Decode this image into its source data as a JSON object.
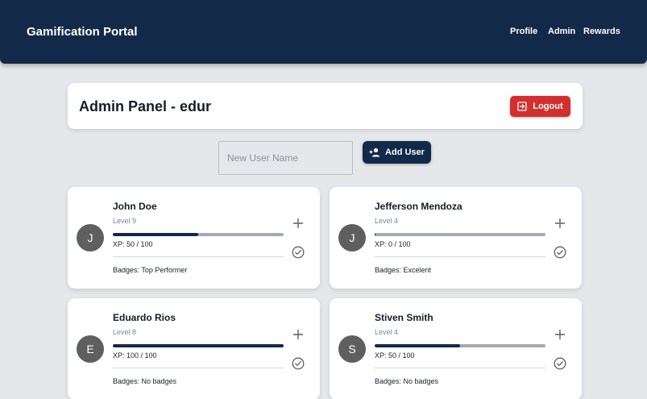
{
  "header": {
    "title": "Gamification Portal",
    "nav": [
      "Profile",
      "Admin",
      "Rewards"
    ]
  },
  "admin_panel": {
    "title": "Admin Panel - edur",
    "logout_label": "Logout",
    "logout_icon": "logout-icon",
    "logout_color": "#d32f2f"
  },
  "add_user": {
    "placeholder": "New User Name",
    "value": "",
    "button_label": "Add User",
    "button_icon": "person-add-icon"
  },
  "users": [
    {
      "initial": "J",
      "name": "John Doe",
      "level": "Level 9",
      "xp_text": "XP: 50 / 100",
      "xp_progress": 0.5,
      "badges": "Badges: Top Performer"
    },
    {
      "initial": "J",
      "name": "Jefferson Mendoza",
      "level": "Level 4",
      "xp_text": "XP: 0 / 100",
      "xp_progress": 0.0,
      "badges": "Badges: Excelent"
    },
    {
      "initial": "E",
      "name": "Eduardo Rios",
      "level": "Level 8",
      "xp_text": "XP: 100 / 100",
      "xp_progress": 1.0,
      "badges": "Badges: No badges"
    },
    {
      "initial": "S",
      "name": "Stiven Smith",
      "level": "Level 4",
      "xp_text": "XP: 50 / 100",
      "xp_progress": 0.5,
      "badges": "Badges: No badges"
    }
  ],
  "colors": {
    "navbar": "#12294a",
    "background": "#e5e7ea",
    "accent": "#12294a",
    "danger": "#d32f2f",
    "avatar": "#5f5f5f"
  }
}
